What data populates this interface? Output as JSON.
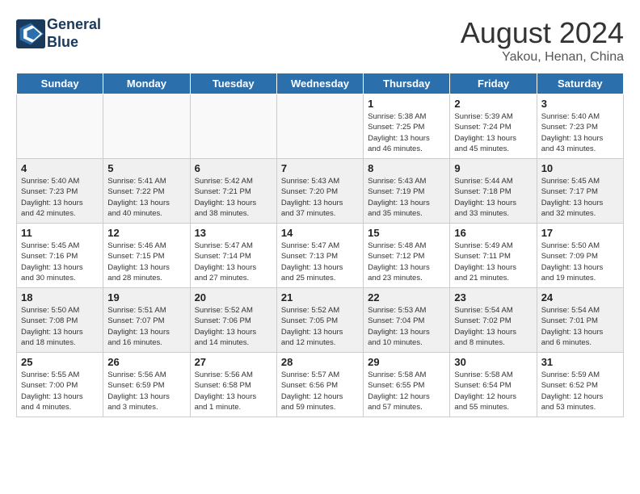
{
  "header": {
    "logo_line1": "General",
    "logo_line2": "Blue",
    "month": "August 2024",
    "location": "Yakou, Henan, China"
  },
  "days_of_week": [
    "Sunday",
    "Monday",
    "Tuesday",
    "Wednesday",
    "Thursday",
    "Friday",
    "Saturday"
  ],
  "weeks": [
    [
      {
        "day": "",
        "info": ""
      },
      {
        "day": "",
        "info": ""
      },
      {
        "day": "",
        "info": ""
      },
      {
        "day": "",
        "info": ""
      },
      {
        "day": "1",
        "info": "Sunrise: 5:38 AM\nSunset: 7:25 PM\nDaylight: 13 hours\nand 46 minutes."
      },
      {
        "day": "2",
        "info": "Sunrise: 5:39 AM\nSunset: 7:24 PM\nDaylight: 13 hours\nand 45 minutes."
      },
      {
        "day": "3",
        "info": "Sunrise: 5:40 AM\nSunset: 7:23 PM\nDaylight: 13 hours\nand 43 minutes."
      }
    ],
    [
      {
        "day": "4",
        "info": "Sunrise: 5:40 AM\nSunset: 7:23 PM\nDaylight: 13 hours\nand 42 minutes."
      },
      {
        "day": "5",
        "info": "Sunrise: 5:41 AM\nSunset: 7:22 PM\nDaylight: 13 hours\nand 40 minutes."
      },
      {
        "day": "6",
        "info": "Sunrise: 5:42 AM\nSunset: 7:21 PM\nDaylight: 13 hours\nand 38 minutes."
      },
      {
        "day": "7",
        "info": "Sunrise: 5:43 AM\nSunset: 7:20 PM\nDaylight: 13 hours\nand 37 minutes."
      },
      {
        "day": "8",
        "info": "Sunrise: 5:43 AM\nSunset: 7:19 PM\nDaylight: 13 hours\nand 35 minutes."
      },
      {
        "day": "9",
        "info": "Sunrise: 5:44 AM\nSunset: 7:18 PM\nDaylight: 13 hours\nand 33 minutes."
      },
      {
        "day": "10",
        "info": "Sunrise: 5:45 AM\nSunset: 7:17 PM\nDaylight: 13 hours\nand 32 minutes."
      }
    ],
    [
      {
        "day": "11",
        "info": "Sunrise: 5:45 AM\nSunset: 7:16 PM\nDaylight: 13 hours\nand 30 minutes."
      },
      {
        "day": "12",
        "info": "Sunrise: 5:46 AM\nSunset: 7:15 PM\nDaylight: 13 hours\nand 28 minutes."
      },
      {
        "day": "13",
        "info": "Sunrise: 5:47 AM\nSunset: 7:14 PM\nDaylight: 13 hours\nand 27 minutes."
      },
      {
        "day": "14",
        "info": "Sunrise: 5:47 AM\nSunset: 7:13 PM\nDaylight: 13 hours\nand 25 minutes."
      },
      {
        "day": "15",
        "info": "Sunrise: 5:48 AM\nSunset: 7:12 PM\nDaylight: 13 hours\nand 23 minutes."
      },
      {
        "day": "16",
        "info": "Sunrise: 5:49 AM\nSunset: 7:11 PM\nDaylight: 13 hours\nand 21 minutes."
      },
      {
        "day": "17",
        "info": "Sunrise: 5:50 AM\nSunset: 7:09 PM\nDaylight: 13 hours\nand 19 minutes."
      }
    ],
    [
      {
        "day": "18",
        "info": "Sunrise: 5:50 AM\nSunset: 7:08 PM\nDaylight: 13 hours\nand 18 minutes."
      },
      {
        "day": "19",
        "info": "Sunrise: 5:51 AM\nSunset: 7:07 PM\nDaylight: 13 hours\nand 16 minutes."
      },
      {
        "day": "20",
        "info": "Sunrise: 5:52 AM\nSunset: 7:06 PM\nDaylight: 13 hours\nand 14 minutes."
      },
      {
        "day": "21",
        "info": "Sunrise: 5:52 AM\nSunset: 7:05 PM\nDaylight: 13 hours\nand 12 minutes."
      },
      {
        "day": "22",
        "info": "Sunrise: 5:53 AM\nSunset: 7:04 PM\nDaylight: 13 hours\nand 10 minutes."
      },
      {
        "day": "23",
        "info": "Sunrise: 5:54 AM\nSunset: 7:02 PM\nDaylight: 13 hours\nand 8 minutes."
      },
      {
        "day": "24",
        "info": "Sunrise: 5:54 AM\nSunset: 7:01 PM\nDaylight: 13 hours\nand 6 minutes."
      }
    ],
    [
      {
        "day": "25",
        "info": "Sunrise: 5:55 AM\nSunset: 7:00 PM\nDaylight: 13 hours\nand 4 minutes."
      },
      {
        "day": "26",
        "info": "Sunrise: 5:56 AM\nSunset: 6:59 PM\nDaylight: 13 hours\nand 3 minutes."
      },
      {
        "day": "27",
        "info": "Sunrise: 5:56 AM\nSunset: 6:58 PM\nDaylight: 13 hours\nand 1 minute."
      },
      {
        "day": "28",
        "info": "Sunrise: 5:57 AM\nSunset: 6:56 PM\nDaylight: 12 hours\nand 59 minutes."
      },
      {
        "day": "29",
        "info": "Sunrise: 5:58 AM\nSunset: 6:55 PM\nDaylight: 12 hours\nand 57 minutes."
      },
      {
        "day": "30",
        "info": "Sunrise: 5:58 AM\nSunset: 6:54 PM\nDaylight: 12 hours\nand 55 minutes."
      },
      {
        "day": "31",
        "info": "Sunrise: 5:59 AM\nSunset: 6:52 PM\nDaylight: 12 hours\nand 53 minutes."
      }
    ]
  ]
}
